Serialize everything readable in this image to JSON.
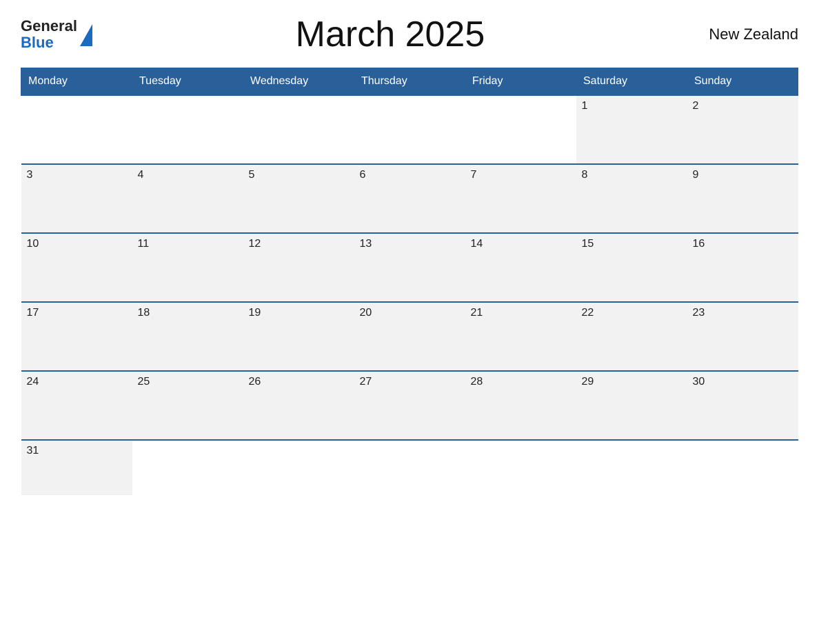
{
  "header": {
    "logo_general": "General",
    "logo_blue": "Blue",
    "title": "March 2025",
    "country": "New Zealand"
  },
  "calendar": {
    "days_of_week": [
      "Monday",
      "Tuesday",
      "Wednesday",
      "Thursday",
      "Friday",
      "Saturday",
      "Sunday"
    ],
    "weeks": [
      [
        {
          "day": "",
          "empty": true
        },
        {
          "day": "",
          "empty": true
        },
        {
          "day": "",
          "empty": true
        },
        {
          "day": "",
          "empty": true
        },
        {
          "day": "",
          "empty": true
        },
        {
          "day": "1",
          "empty": false
        },
        {
          "day": "2",
          "empty": false
        }
      ],
      [
        {
          "day": "3",
          "empty": false
        },
        {
          "day": "4",
          "empty": false
        },
        {
          "day": "5",
          "empty": false
        },
        {
          "day": "6",
          "empty": false
        },
        {
          "day": "7",
          "empty": false
        },
        {
          "day": "8",
          "empty": false
        },
        {
          "day": "9",
          "empty": false
        }
      ],
      [
        {
          "day": "10",
          "empty": false
        },
        {
          "day": "11",
          "empty": false
        },
        {
          "day": "12",
          "empty": false
        },
        {
          "day": "13",
          "empty": false
        },
        {
          "day": "14",
          "empty": false
        },
        {
          "day": "15",
          "empty": false
        },
        {
          "day": "16",
          "empty": false
        }
      ],
      [
        {
          "day": "17",
          "empty": false
        },
        {
          "day": "18",
          "empty": false
        },
        {
          "day": "19",
          "empty": false
        },
        {
          "day": "20",
          "empty": false
        },
        {
          "day": "21",
          "empty": false
        },
        {
          "day": "22",
          "empty": false
        },
        {
          "day": "23",
          "empty": false
        }
      ],
      [
        {
          "day": "24",
          "empty": false
        },
        {
          "day": "25",
          "empty": false
        },
        {
          "day": "26",
          "empty": false
        },
        {
          "day": "27",
          "empty": false
        },
        {
          "day": "28",
          "empty": false
        },
        {
          "day": "29",
          "empty": false
        },
        {
          "day": "30",
          "empty": false
        }
      ],
      [
        {
          "day": "31",
          "empty": false
        },
        {
          "day": "",
          "empty": true,
          "after": true
        },
        {
          "day": "",
          "empty": true,
          "after": true
        },
        {
          "day": "",
          "empty": true,
          "after": true
        },
        {
          "day": "",
          "empty": true,
          "after": true
        },
        {
          "day": "",
          "empty": true,
          "after": true
        },
        {
          "day": "",
          "empty": true,
          "after": true
        }
      ]
    ]
  }
}
